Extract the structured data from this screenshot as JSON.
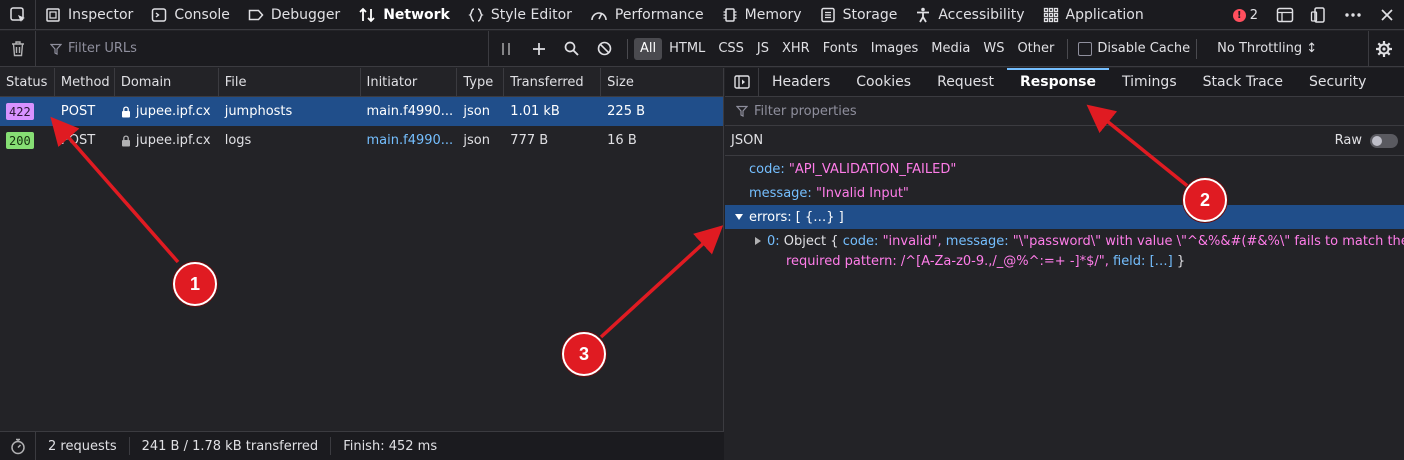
{
  "toolbox": {
    "tabs": [
      {
        "label": "Inspector",
        "icon": "inspector-icon"
      },
      {
        "label": "Console",
        "icon": "console-icon"
      },
      {
        "label": "Debugger",
        "icon": "debugger-icon"
      },
      {
        "label": "Network",
        "icon": "network-icon",
        "active": true
      },
      {
        "label": "Style Editor",
        "icon": "style-editor-icon"
      },
      {
        "label": "Performance",
        "icon": "performance-icon"
      },
      {
        "label": "Memory",
        "icon": "memory-icon"
      },
      {
        "label": "Storage",
        "icon": "storage-icon"
      },
      {
        "label": "Accessibility",
        "icon": "accessibility-icon"
      },
      {
        "label": "Application",
        "icon": "application-icon"
      }
    ],
    "error_count": "2"
  },
  "network_toolbar": {
    "filter_placeholder": "Filter URLs",
    "type_filters": [
      "All",
      "HTML",
      "CSS",
      "JS",
      "XHR",
      "Fonts",
      "Images",
      "Media",
      "WS",
      "Other"
    ],
    "active_filter": "All",
    "disable_cache_label": "Disable Cache",
    "throttling_label": "No Throttling ↕"
  },
  "request_table": {
    "columns": [
      "Status",
      "Method",
      "Domain",
      "File",
      "Initiator",
      "Type",
      "Transferred",
      "Size"
    ],
    "rows": [
      {
        "status": "422",
        "method": "POST",
        "domain": "jupee.ipf.cx",
        "file": "jumphosts",
        "initiator": "main.f4990...",
        "type": "json",
        "transferred": "1.01 kB",
        "size": "225 B"
      },
      {
        "status": "200",
        "method": "POST",
        "domain": "jupee.ipf.cx",
        "file": "logs",
        "initiator": "main.f4990...",
        "type": "json",
        "transferred": "777 B",
        "size": "16 B"
      }
    ]
  },
  "footer": {
    "requests": "2 requests",
    "transferred": "241 B / 1.78 kB transferred",
    "finish": "Finish: 452 ms"
  },
  "details": {
    "tabs": [
      "Headers",
      "Cookies",
      "Request",
      "Response",
      "Timings",
      "Stack Trace",
      "Security"
    ],
    "active_tab": "Response",
    "filter_placeholder": "Filter properties",
    "json_label": "JSON",
    "raw_label": "Raw",
    "json": {
      "code_key": "code:",
      "code_val": "\"API_VALIDATION_FAILED\"",
      "message_key": "message:",
      "message_val": "\"Invalid Input\"",
      "errors_key": "errors:",
      "errors_val": "[ {…} ]",
      "item_index": "0:",
      "item_prefix": "Object {",
      "item_code_key": "code:",
      "item_code_val": "\"invalid\",",
      "item_msg_key": "message:",
      "item_msg_val_1": "\"\\\"password\\\" with value \\\"^&%&#(#&%\\\" fails to match the",
      "item_msg_val_2": "required pattern: /^[A-Za-z0-9.,/_@%^:=+ -]*$/\",",
      "item_field_key": "field:",
      "item_field_val": "[…]",
      "item_suffix": "}"
    }
  },
  "annotations": [
    "1",
    "2",
    "3"
  ],
  "colors": {
    "annotation_red": "#e01b22",
    "selection_blue": "#204e8a",
    "status_422": "#d892ff",
    "status_200": "#86de74",
    "json_key": "#75bfff",
    "json_string": "#ff7de9"
  }
}
